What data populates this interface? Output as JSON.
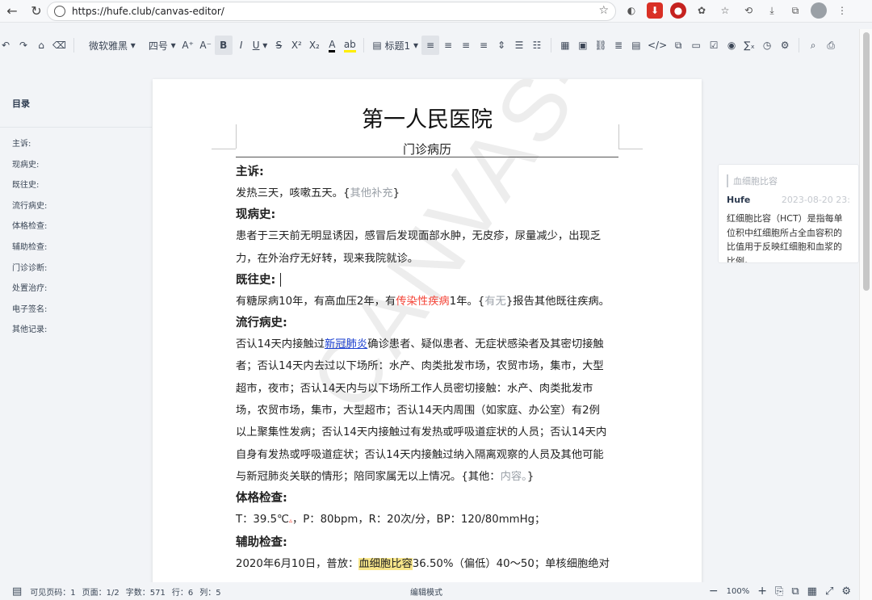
{
  "browser": {
    "url": "https://hufe.club/canvas-editor/",
    "back": "←",
    "reload": "↻",
    "star": "☆",
    "extensions": [
      "◐",
      "⬇",
      "●",
      "✿",
      "☆",
      "⟲",
      "⤓",
      "⧉",
      "⋮"
    ]
  },
  "toolbar": {
    "undo": "↶",
    "redo": "↷",
    "painter": "⌂",
    "clear": "⌫",
    "font": "微软雅黑",
    "size": "四号",
    "size_add": "A⁺",
    "size_minus": "A⁻",
    "bold": "B",
    "italic": "I",
    "underline": "U",
    "strike": "S",
    "superscript": "X²",
    "subscript": "X₂",
    "color": "A",
    "highlight": "ab",
    "title_select": "标题1",
    "align_left": "≡",
    "align_center": "≡",
    "align_right": "≡",
    "align_justify": "≡",
    "row_margin": "⇕",
    "list_a": "☰",
    "list_b": "☷",
    "table": "▦",
    "image": "▣",
    "hyperlink": "⛓",
    "separator": "≣",
    "watermark": "▤",
    "codeblock": "</>",
    "pagebreak": "⧉",
    "control": "▭",
    "checkbox": "☑",
    "radio": "◉",
    "latex": "∑ₓ",
    "date": "◷",
    "block": "⚙",
    "search": "⌕",
    "print": "⎙"
  },
  "toc": {
    "title": "目录",
    "items": [
      "主诉:",
      "现病史:",
      "既往史:",
      "流行病史:",
      "体格检查:",
      "辅助检查:",
      "门诊诊断:",
      "处置治疗:",
      "电子签名:",
      "其他记录:"
    ]
  },
  "document": {
    "title": "第一人民医院",
    "subtitle": "门诊病历",
    "watermark": "CANVAS-EDITOR",
    "sections": {
      "s1_heading": "主诉:",
      "s1_text": "发热三天，咳嗽五天。",
      "s1_ph_open": "{",
      "s1_ph": "其他补充",
      "s1_ph_close": "}",
      "s2_heading": "现病史:",
      "s2_line1": "患者于三天前无明显诱因，感冒后发现面部水肿，无皮疹，尿量减少，出现乏",
      "s2_line2": "力，在外治疗无好转，现来我院就诊。",
      "s3_heading": "既往史:",
      "s3_pre": "有糖尿病10年，有高血压2年，有",
      "s3_red": "传染性疾病",
      "s3_mid": "1年。{",
      "s3_ph": "有无",
      "s3_post": "}报告其他既往疾病。",
      "s4_heading": "流行病史:",
      "s4_pre": "否认14天内接触过",
      "s4_link": "新冠肺炎",
      "s4_l1_rest": "确诊患者、疑似患者、无症状感染者及其密切接触",
      "s4_line2": "者；否认14天内去过以下场所：水产、肉类批发市场，农贸市场，集市，大型",
      "s4_line3": "超市，夜市；否认14天内与以下场所工作人员密切接触：水产、肉类批发市",
      "s4_line4": "场，农贸市场，集市，大型超市；否认14天内周围（如家庭、办公室）有2例",
      "s4_line5": "以上聚集性发病；否认14天内接触过有发热或呼吸道症状的人员；否认14天内",
      "s4_line6": "自身有发热或呼吸道症状；否认14天内接触过纳入隔离观察的人员及其他可能",
      "s4_line7_pre": "与新冠肺炎关联的情形；陪同家属无以上情况。{其他：",
      "s4_ph": "内容。",
      "s4_line7_post": "}",
      "s5_heading": "体格检查:",
      "s5_pre": "T：39.5℃",
      "s5_mark": "▵",
      "s5_post": "，P：80bpm，R：20次/分，BP：120/80mmHg；",
      "s6_heading": "辅助检查:",
      "s6_pre": "2020年6月10日，普放：",
      "s6_hl": "血细胞比容",
      "s6_post": "36.50%（偏低）40～50；单核细胞绝对"
    }
  },
  "comment": {
    "quote": "血细胞比容",
    "user": "Hufe",
    "time": "2023-08-20 23:",
    "text": "红细胞比容（HCT）是指每单位积中红细胞所占全血容积的比值用于反映红细胞和血浆的比例。"
  },
  "status": {
    "page_icon": "▤",
    "visible_pages": "可见页码：1",
    "pages": "页面：1/2",
    "words": "字数：571",
    "row": "行：6",
    "col": "列：5",
    "mode": "编辑模式",
    "zoom_out": "−",
    "zoom": "100%",
    "zoom_in": "+",
    "icons": [
      "⎘",
      "⧉",
      "▦",
      "⤢",
      "⚙"
    ]
  },
  "colors": {
    "accent_link": "#1a3fd1",
    "red_text": "#f44336",
    "highlight": "#f8e68a"
  }
}
